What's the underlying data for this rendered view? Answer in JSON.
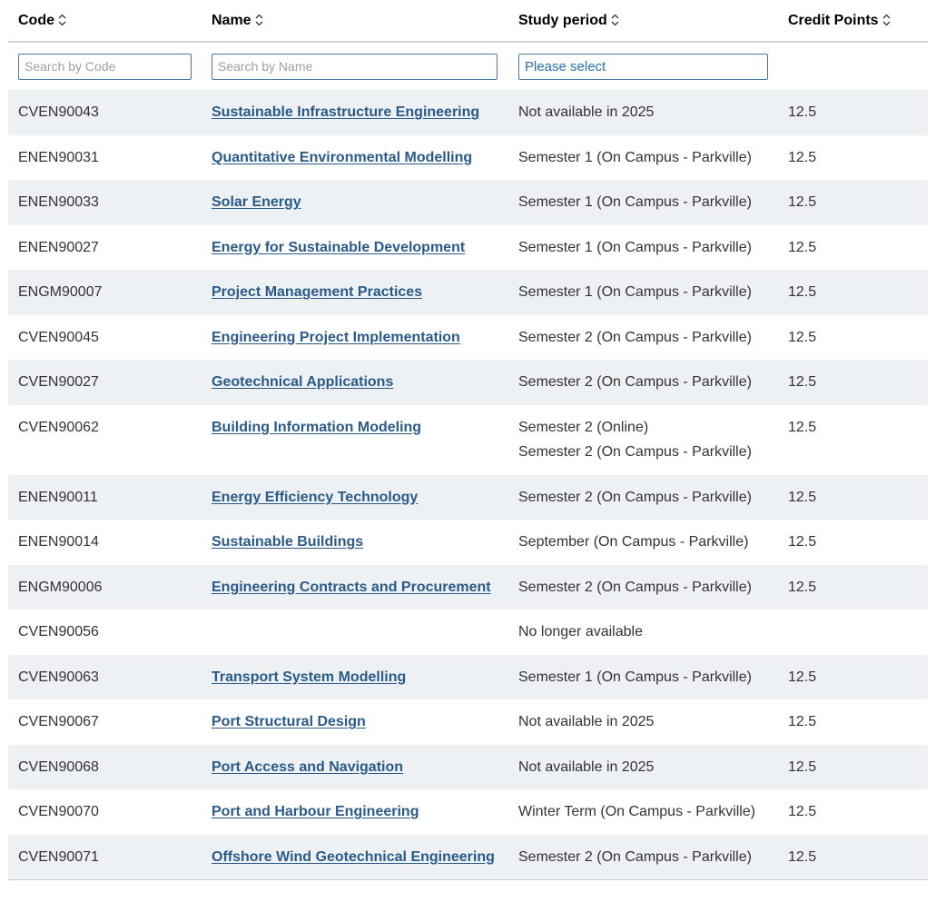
{
  "headers": {
    "code": "Code",
    "name": "Name",
    "period": "Study period",
    "credit": "Credit Points"
  },
  "filters": {
    "code_placeholder": "Search by Code",
    "name_placeholder": "Search by Name",
    "period_select_value": "Please select"
  },
  "rows": [
    {
      "code": "CVEN90043",
      "name": "Sustainable Infrastructure Engineering",
      "periods": [
        "Not available in 2025"
      ],
      "credit": "12.5"
    },
    {
      "code": "ENEN90031",
      "name": "Quantitative Environmental Modelling",
      "periods": [
        "Semester 1 (On Campus - Parkville)"
      ],
      "credit": "12.5"
    },
    {
      "code": "ENEN90033",
      "name": "Solar Energy",
      "periods": [
        "Semester 1 (On Campus - Parkville)"
      ],
      "credit": "12.5"
    },
    {
      "code": "ENEN90027",
      "name": "Energy for Sustainable Development",
      "periods": [
        "Semester 1 (On Campus - Parkville)"
      ],
      "credit": "12.5"
    },
    {
      "code": "ENGM90007",
      "name": "Project Management Practices",
      "periods": [
        "Semester 1 (On Campus - Parkville)"
      ],
      "credit": "12.5"
    },
    {
      "code": "CVEN90045",
      "name": "Engineering Project Implementation",
      "periods": [
        "Semester 2 (On Campus - Parkville)"
      ],
      "credit": "12.5"
    },
    {
      "code": "CVEN90027",
      "name": "Geotechnical Applications",
      "periods": [
        "Semester 2 (On Campus - Parkville)"
      ],
      "credit": "12.5"
    },
    {
      "code": "CVEN90062",
      "name": "Building Information Modeling",
      "periods": [
        "Semester 2 (Online)",
        "Semester 2 (On Campus - Parkville)"
      ],
      "credit": "12.5"
    },
    {
      "code": "ENEN90011",
      "name": "Energy Efficiency Technology",
      "periods": [
        "Semester 2 (On Campus - Parkville)"
      ],
      "credit": "12.5"
    },
    {
      "code": "ENEN90014",
      "name": "Sustainable Buildings",
      "periods": [
        "September (On Campus - Parkville)"
      ],
      "credit": "12.5"
    },
    {
      "code": "ENGM90006",
      "name": "Engineering Contracts and Procurement",
      "periods": [
        "Semester 2 (On Campus - Parkville)"
      ],
      "credit": "12.5"
    },
    {
      "code": "CVEN90056",
      "name": "",
      "periods": [
        "No longer available"
      ],
      "credit": ""
    },
    {
      "code": "CVEN90063",
      "name": "Transport System Modelling",
      "periods": [
        "Semester 1 (On Campus - Parkville)"
      ],
      "credit": "12.5"
    },
    {
      "code": "CVEN90067",
      "name": "Port Structural Design",
      "periods": [
        "Not available in 2025"
      ],
      "credit": "12.5"
    },
    {
      "code": "CVEN90068",
      "name": "Port Access and Navigation",
      "periods": [
        "Not available in 2025"
      ],
      "credit": "12.5"
    },
    {
      "code": "CVEN90070",
      "name": "Port and Harbour Engineering",
      "periods": [
        "Winter Term (On Campus - Parkville)"
      ],
      "credit": "12.5"
    },
    {
      "code": "CVEN90071",
      "name": "Offshore Wind Geotechnical Engineering",
      "periods": [
        "Semester 2 (On Campus - Parkville)"
      ],
      "credit": "12.5"
    }
  ],
  "colors": {
    "link": "#2a5a8a",
    "stripe": "#edf1f4",
    "input_border": "#4a77a0"
  },
  "icons": {
    "sort": "sort-icon"
  }
}
